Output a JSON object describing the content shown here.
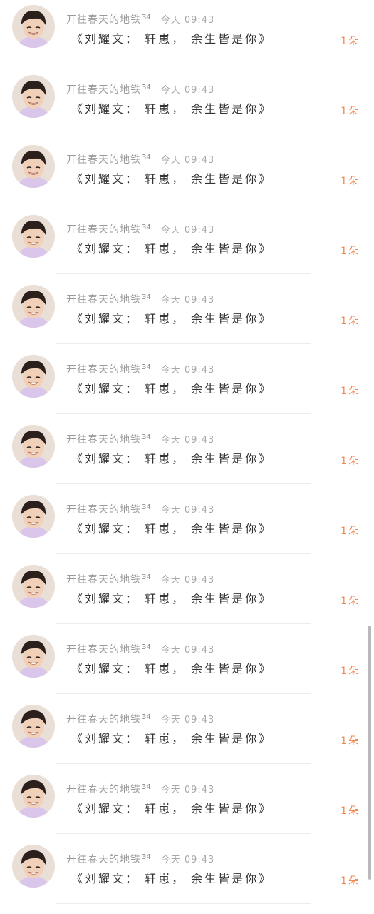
{
  "colors": {
    "background": "#ffffff",
    "meta_text": "#9a9a9a",
    "message_text": "#333333",
    "count_accent": "#f08a52",
    "divider": "#ececec",
    "scrollbar": "#b9b9b9"
  },
  "messages": [
    {
      "avatar_icon": "avatar-photo",
      "sender": "开往春天的地铁",
      "badge": "34",
      "time": "今天 09:43",
      "text": "《刘耀文： 轩崽， 余生皆是你》",
      "count": "1朵"
    },
    {
      "avatar_icon": "avatar-photo",
      "sender": "开往春天的地铁",
      "badge": "34",
      "time": "今天 09:43",
      "text": "《刘耀文： 轩崽， 余生皆是你》",
      "count": "1朵"
    },
    {
      "avatar_icon": "avatar-photo",
      "sender": "开往春天的地铁",
      "badge": "34",
      "time": "今天 09:43",
      "text": "《刘耀文： 轩崽， 余生皆是你》",
      "count": "1朵"
    },
    {
      "avatar_icon": "avatar-photo",
      "sender": "开往春天的地铁",
      "badge": "34",
      "time": "今天 09:43",
      "text": "《刘耀文： 轩崽， 余生皆是你》",
      "count": "1朵"
    },
    {
      "avatar_icon": "avatar-photo",
      "sender": "开往春天的地铁",
      "badge": "34",
      "time": "今天 09:43",
      "text": "《刘耀文： 轩崽， 余生皆是你》",
      "count": "1朵"
    },
    {
      "avatar_icon": "avatar-photo",
      "sender": "开往春天的地铁",
      "badge": "34",
      "time": "今天 09:43",
      "text": "《刘耀文： 轩崽， 余生皆是你》",
      "count": "1朵"
    },
    {
      "avatar_icon": "avatar-photo",
      "sender": "开往春天的地铁",
      "badge": "34",
      "time": "今天 09:43",
      "text": "《刘耀文： 轩崽， 余生皆是你》",
      "count": "1朵"
    },
    {
      "avatar_icon": "avatar-photo",
      "sender": "开往春天的地铁",
      "badge": "34",
      "time": "今天 09:43",
      "text": "《刘耀文： 轩崽， 余生皆是你》",
      "count": "1朵"
    },
    {
      "avatar_icon": "avatar-photo",
      "sender": "开往春天的地铁",
      "badge": "34",
      "time": "今天 09:43",
      "text": "《刘耀文： 轩崽， 余生皆是你》",
      "count": "1朵"
    },
    {
      "avatar_icon": "avatar-photo",
      "sender": "开往春天的地铁",
      "badge": "34",
      "time": "今天 09:43",
      "text": "《刘耀文： 轩崽， 余生皆是你》",
      "count": "1朵"
    },
    {
      "avatar_icon": "avatar-photo",
      "sender": "开往春天的地铁",
      "badge": "34",
      "time": "今天 09:43",
      "text": "《刘耀文： 轩崽， 余生皆是你》",
      "count": "1朵"
    },
    {
      "avatar_icon": "avatar-photo",
      "sender": "开往春天的地铁",
      "badge": "34",
      "time": "今天 09:43",
      "text": "《刘耀文： 轩崽， 余生皆是你》",
      "count": "1朵"
    },
    {
      "avatar_icon": "avatar-photo",
      "sender": "开往春天的地铁",
      "badge": "34",
      "time": "今天 09:43",
      "text": "《刘耀文： 轩崽， 余生皆是你》",
      "count": "1朵"
    }
  ]
}
